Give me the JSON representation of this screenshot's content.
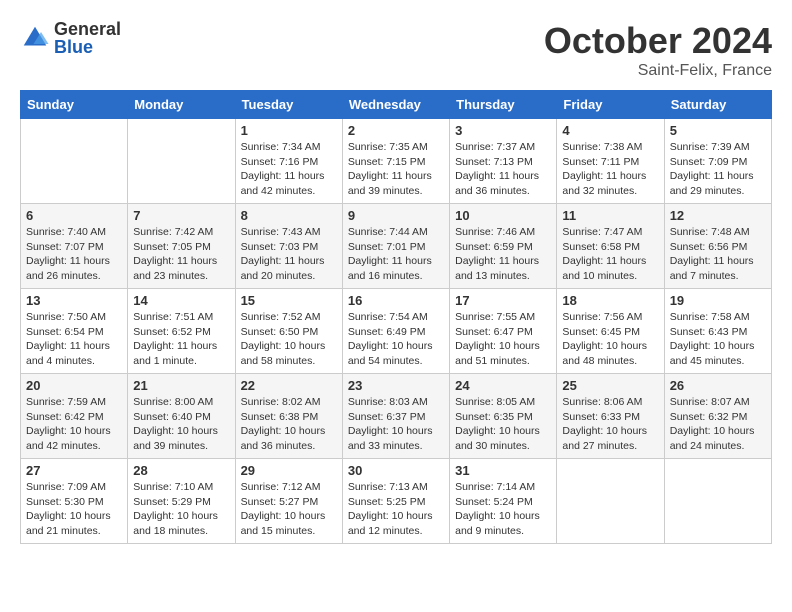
{
  "logo": {
    "general": "General",
    "blue": "Blue"
  },
  "title": {
    "month": "October 2024",
    "location": "Saint-Felix, France"
  },
  "days_of_week": [
    "Sunday",
    "Monday",
    "Tuesday",
    "Wednesday",
    "Thursday",
    "Friday",
    "Saturday"
  ],
  "weeks": [
    [
      {
        "day": "",
        "sunrise": "",
        "sunset": "",
        "daylight": ""
      },
      {
        "day": "",
        "sunrise": "",
        "sunset": "",
        "daylight": ""
      },
      {
        "day": "1",
        "sunrise": "Sunrise: 7:34 AM",
        "sunset": "Sunset: 7:16 PM",
        "daylight": "Daylight: 11 hours and 42 minutes."
      },
      {
        "day": "2",
        "sunrise": "Sunrise: 7:35 AM",
        "sunset": "Sunset: 7:15 PM",
        "daylight": "Daylight: 11 hours and 39 minutes."
      },
      {
        "day": "3",
        "sunrise": "Sunrise: 7:37 AM",
        "sunset": "Sunset: 7:13 PM",
        "daylight": "Daylight: 11 hours and 36 minutes."
      },
      {
        "day": "4",
        "sunrise": "Sunrise: 7:38 AM",
        "sunset": "Sunset: 7:11 PM",
        "daylight": "Daylight: 11 hours and 32 minutes."
      },
      {
        "day": "5",
        "sunrise": "Sunrise: 7:39 AM",
        "sunset": "Sunset: 7:09 PM",
        "daylight": "Daylight: 11 hours and 29 minutes."
      }
    ],
    [
      {
        "day": "6",
        "sunrise": "Sunrise: 7:40 AM",
        "sunset": "Sunset: 7:07 PM",
        "daylight": "Daylight: 11 hours and 26 minutes."
      },
      {
        "day": "7",
        "sunrise": "Sunrise: 7:42 AM",
        "sunset": "Sunset: 7:05 PM",
        "daylight": "Daylight: 11 hours and 23 minutes."
      },
      {
        "day": "8",
        "sunrise": "Sunrise: 7:43 AM",
        "sunset": "Sunset: 7:03 PM",
        "daylight": "Daylight: 11 hours and 20 minutes."
      },
      {
        "day": "9",
        "sunrise": "Sunrise: 7:44 AM",
        "sunset": "Sunset: 7:01 PM",
        "daylight": "Daylight: 11 hours and 16 minutes."
      },
      {
        "day": "10",
        "sunrise": "Sunrise: 7:46 AM",
        "sunset": "Sunset: 6:59 PM",
        "daylight": "Daylight: 11 hours and 13 minutes."
      },
      {
        "day": "11",
        "sunrise": "Sunrise: 7:47 AM",
        "sunset": "Sunset: 6:58 PM",
        "daylight": "Daylight: 11 hours and 10 minutes."
      },
      {
        "day": "12",
        "sunrise": "Sunrise: 7:48 AM",
        "sunset": "Sunset: 6:56 PM",
        "daylight": "Daylight: 11 hours and 7 minutes."
      }
    ],
    [
      {
        "day": "13",
        "sunrise": "Sunrise: 7:50 AM",
        "sunset": "Sunset: 6:54 PM",
        "daylight": "Daylight: 11 hours and 4 minutes."
      },
      {
        "day": "14",
        "sunrise": "Sunrise: 7:51 AM",
        "sunset": "Sunset: 6:52 PM",
        "daylight": "Daylight: 11 hours and 1 minute."
      },
      {
        "day": "15",
        "sunrise": "Sunrise: 7:52 AM",
        "sunset": "Sunset: 6:50 PM",
        "daylight": "Daylight: 10 hours and 58 minutes."
      },
      {
        "day": "16",
        "sunrise": "Sunrise: 7:54 AM",
        "sunset": "Sunset: 6:49 PM",
        "daylight": "Daylight: 10 hours and 54 minutes."
      },
      {
        "day": "17",
        "sunrise": "Sunrise: 7:55 AM",
        "sunset": "Sunset: 6:47 PM",
        "daylight": "Daylight: 10 hours and 51 minutes."
      },
      {
        "day": "18",
        "sunrise": "Sunrise: 7:56 AM",
        "sunset": "Sunset: 6:45 PM",
        "daylight": "Daylight: 10 hours and 48 minutes."
      },
      {
        "day": "19",
        "sunrise": "Sunrise: 7:58 AM",
        "sunset": "Sunset: 6:43 PM",
        "daylight": "Daylight: 10 hours and 45 minutes."
      }
    ],
    [
      {
        "day": "20",
        "sunrise": "Sunrise: 7:59 AM",
        "sunset": "Sunset: 6:42 PM",
        "daylight": "Daylight: 10 hours and 42 minutes."
      },
      {
        "day": "21",
        "sunrise": "Sunrise: 8:00 AM",
        "sunset": "Sunset: 6:40 PM",
        "daylight": "Daylight: 10 hours and 39 minutes."
      },
      {
        "day": "22",
        "sunrise": "Sunrise: 8:02 AM",
        "sunset": "Sunset: 6:38 PM",
        "daylight": "Daylight: 10 hours and 36 minutes."
      },
      {
        "day": "23",
        "sunrise": "Sunrise: 8:03 AM",
        "sunset": "Sunset: 6:37 PM",
        "daylight": "Daylight: 10 hours and 33 minutes."
      },
      {
        "day": "24",
        "sunrise": "Sunrise: 8:05 AM",
        "sunset": "Sunset: 6:35 PM",
        "daylight": "Daylight: 10 hours and 30 minutes."
      },
      {
        "day": "25",
        "sunrise": "Sunrise: 8:06 AM",
        "sunset": "Sunset: 6:33 PM",
        "daylight": "Daylight: 10 hours and 27 minutes."
      },
      {
        "day": "26",
        "sunrise": "Sunrise: 8:07 AM",
        "sunset": "Sunset: 6:32 PM",
        "daylight": "Daylight: 10 hours and 24 minutes."
      }
    ],
    [
      {
        "day": "27",
        "sunrise": "Sunrise: 7:09 AM",
        "sunset": "Sunset: 5:30 PM",
        "daylight": "Daylight: 10 hours and 21 minutes."
      },
      {
        "day": "28",
        "sunrise": "Sunrise: 7:10 AM",
        "sunset": "Sunset: 5:29 PM",
        "daylight": "Daylight: 10 hours and 18 minutes."
      },
      {
        "day": "29",
        "sunrise": "Sunrise: 7:12 AM",
        "sunset": "Sunset: 5:27 PM",
        "daylight": "Daylight: 10 hours and 15 minutes."
      },
      {
        "day": "30",
        "sunrise": "Sunrise: 7:13 AM",
        "sunset": "Sunset: 5:25 PM",
        "daylight": "Daylight: 10 hours and 12 minutes."
      },
      {
        "day": "31",
        "sunrise": "Sunrise: 7:14 AM",
        "sunset": "Sunset: 5:24 PM",
        "daylight": "Daylight: 10 hours and 9 minutes."
      },
      {
        "day": "",
        "sunrise": "",
        "sunset": "",
        "daylight": ""
      },
      {
        "day": "",
        "sunrise": "",
        "sunset": "",
        "daylight": ""
      }
    ]
  ]
}
